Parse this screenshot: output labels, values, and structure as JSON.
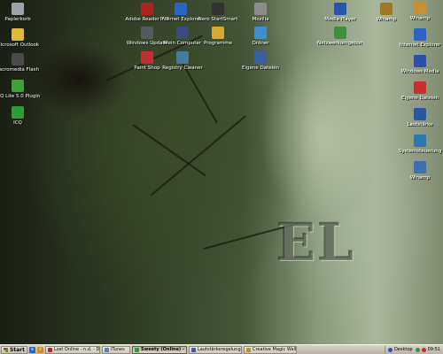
{
  "desktop": {
    "icons_left": [
      {
        "label": "Papierkorb",
        "icon": "recycle-bin-icon",
        "color": "#9aa4a8"
      },
      {
        "label": "Microsoft Outlook",
        "icon": "outlook-icon",
        "color": "#e0b93a"
      },
      {
        "label": "Macromedia Flash Player",
        "icon": "flash-icon",
        "color": "#4a4a4a"
      },
      {
        "label": "ICQ Lite 5.0 Plugin",
        "icon": "icq-icon",
        "color": "#3da33a"
      },
      {
        "label": "ICQ",
        "icon": "icq-flower-icon",
        "color": "#2e9c3c"
      }
    ],
    "icons_row1": [
      {
        "label": "Adobe Reader 7.0",
        "icon": "adobe-reader-icon",
        "color": "#b02121"
      },
      {
        "label": "Internet Explorer",
        "icon": "internet-explorer-icon",
        "color": "#2b63c8"
      },
      {
        "label": "Nero StartSmart",
        "icon": "nero-icon",
        "color": "#333333"
      },
      {
        "label": "Mozilla",
        "icon": "mozilla-icon",
        "color": "#8c8c8c"
      },
      {
        "label": "Media Player",
        "icon": "media-player-icon",
        "color": "#2b53b0"
      },
      {
        "label": "Winamp",
        "icon": "winamp-icon",
        "color": "#9a7a25"
      }
    ],
    "icons_row2": [
      {
        "label": "Windows Update",
        "icon": "windows-update-icon",
        "color": "#555a60"
      },
      {
        "label": "Mein Computer",
        "icon": "my-computer-icon",
        "color": "#3c4a76"
      },
      {
        "label": "Programme",
        "icon": "folder-icon",
        "color": "#d8a830"
      },
      {
        "label": "Ordner",
        "icon": "folder-icon",
        "color": "#3f8fd0"
      },
      {
        "label": "Netzwerkumgebung",
        "icon": "network-icon",
        "color": "#3f8f3f"
      }
    ],
    "icons_row3": [
      {
        "label": "Paint Shop",
        "icon": "paint-icon",
        "color": "#c03030"
      },
      {
        "label": "Registry Cleaner",
        "icon": "cleaner-icon",
        "color": "#4a7c9a"
      },
      {
        "label": "Eigene Dateien",
        "icon": "documents-icon",
        "color": "#3b5ea6"
      }
    ],
    "icons_right": [
      {
        "label": "Winamp",
        "icon": "winamp-icon",
        "color": "#c99030"
      },
      {
        "label": "Internet Explorer",
        "icon": "internet-explorer-icon",
        "color": "#2b63c8"
      },
      {
        "label": "Windows Media",
        "icon": "media-icon",
        "color": "#2b4fb0"
      },
      {
        "label": "Eigene Dateien",
        "icon": "documents-icon",
        "color": "#c83030"
      },
      {
        "label": "Lautstärke",
        "icon": "volume-icon",
        "color": "#2a55a0"
      },
      {
        "label": "Systemsteuerung",
        "icon": "control-panel-icon",
        "color": "#2a7ab0"
      },
      {
        "label": "Winamp",
        "icon": "winamp-icon",
        "color": "#3f6fb0"
      }
    ],
    "wallpaper_text": "EL"
  },
  "taskbar": {
    "start_label": "Start",
    "tasks": [
      {
        "label": "Lost Online - n.d. - Die d...",
        "color": "#a62b2b",
        "active": false
      },
      {
        "label": "iTunes",
        "color": "#5a7fc0",
        "active": false
      },
      {
        "label": "Sweety (Online) - Me...",
        "color": "#2f9a3a",
        "active": true
      },
      {
        "label": "Lautstärkeregelung",
        "color": "#3a5ea8",
        "active": false
      },
      {
        "label": "Creative Magic Wallpap...",
        "color": "#c0902a",
        "active": false
      }
    ],
    "desktop_label": "Desktop",
    "clock": "09:51"
  }
}
